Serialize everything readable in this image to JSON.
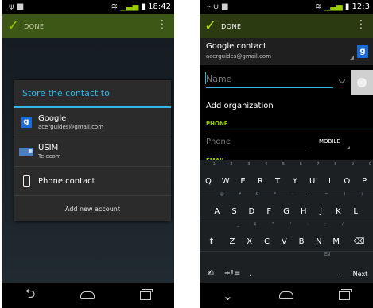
{
  "left_screen": {
    "status": {
      "time": "18:42"
    },
    "actionbar": {
      "done_label": "DONE"
    },
    "dialog": {
      "title": "Store the contact to",
      "options": [
        {
          "icon": "google-icon",
          "label": "Google",
          "sublabel": "acerguides@gmail.com"
        },
        {
          "icon": "sim-card-icon",
          "label": "USIM",
          "sublabel": "Telecom"
        },
        {
          "icon": "phone-icon",
          "label": "Phone contact"
        }
      ],
      "add_account": "Add new account"
    }
  },
  "right_screen": {
    "status": {
      "time": "12:3"
    },
    "actionbar": {
      "done_label": "DONE"
    },
    "account": {
      "title": "Google contact",
      "email": "acerguides@gmail.com"
    },
    "form": {
      "name_placeholder": "Name",
      "add_organization": "Add organization",
      "phone_section": "PHONE",
      "phone_placeholder": "Phone",
      "phone_type": "MOBILE",
      "email_section": "EMAIL"
    },
    "keyboard": {
      "row1": [
        {
          "k": "Q",
          "h": "1"
        },
        {
          "k": "W",
          "h": "2"
        },
        {
          "k": "E",
          "h": "3"
        },
        {
          "k": "R",
          "h": "4"
        },
        {
          "k": "T",
          "h": "5"
        },
        {
          "k": "Y",
          "h": "6"
        },
        {
          "k": "U",
          "h": "7"
        },
        {
          "k": "I",
          "h": "8"
        },
        {
          "k": "O",
          "h": "9"
        },
        {
          "k": "P",
          "h": "0"
        }
      ],
      "row2": [
        {
          "k": "A",
          "h": "@"
        },
        {
          "k": "S",
          "h": "#"
        },
        {
          "k": "D",
          "h": "&"
        },
        {
          "k": "F",
          "h": "*"
        },
        {
          "k": "G",
          "h": "-"
        },
        {
          "k": "H",
          "h": "+"
        },
        {
          "k": "J",
          "h": "="
        },
        {
          "k": "K",
          "h": "("
        },
        {
          "k": "L",
          "h": ")"
        }
      ],
      "row3": [
        {
          "k": "Z",
          "h": "_"
        },
        {
          "k": "X",
          "h": "$"
        },
        {
          "k": "C",
          "h": "\""
        },
        {
          "k": "V",
          "h": "'"
        },
        {
          "k": "B",
          "h": ":"
        },
        {
          "k": "N",
          "h": ";"
        },
        {
          "k": "M",
          "h": "/"
        }
      ],
      "space_hint": "EN",
      "symbols_label": "+!=",
      "comma": ",",
      "period": ".",
      "next_label": "Next"
    }
  }
}
